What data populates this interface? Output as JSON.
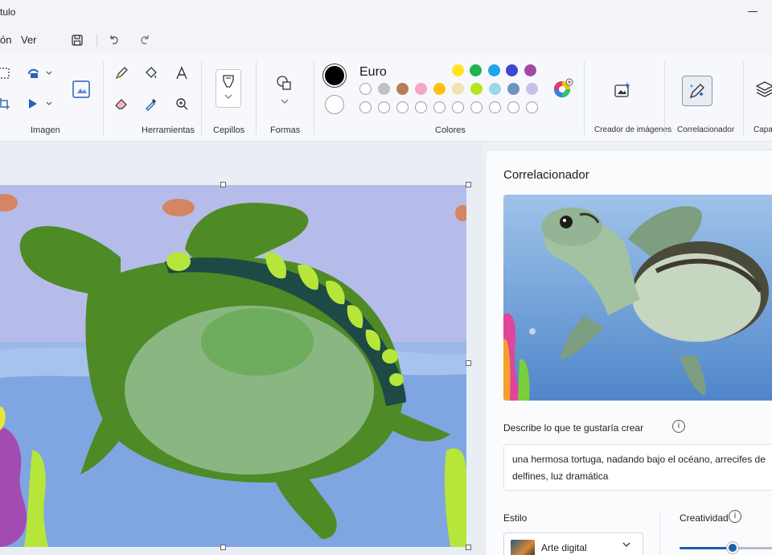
{
  "window": {
    "title": "tulo"
  },
  "menu": {
    "file_partial": "ón",
    "view": "Ver"
  },
  "ribbon": {
    "groups": {
      "image": "Imagen",
      "tools": "Herramientas",
      "brushes": "Cepillos",
      "shapes": "Formas",
      "colors": "Colores",
      "image_creator": "Creador de imágenes",
      "cocreator": "Correlacionador",
      "layers_partial": "Capa"
    },
    "color_name": "Euro",
    "primary_color": "#000000",
    "secondary_color": "#ffffff",
    "palette_row1": [
      "#ffe51e",
      "#22b14c",
      "#1ea7e6",
      "#3f48cc",
      "#a349a4"
    ],
    "palette_row2": [
      "#ffffff",
      "#c3c3c3",
      "#b97a57",
      "#f4a6c9",
      "#ffc20e",
      "#efe4b0",
      "#b5e61d",
      "#99d9ea",
      "#7092be",
      "#c8bfe7"
    ]
  },
  "panel": {
    "title": "Correlacionador",
    "prompt_label": "Describe lo que te gustaría crear",
    "prompt_text": "una hermosa tortuga, nadando bajo el océano, arrecifes de delfines, luz dramática",
    "style_label": "Estilo",
    "style_value": "Arte digital",
    "creativity_label": "Creatividad",
    "creativity_level": 0.55
  }
}
